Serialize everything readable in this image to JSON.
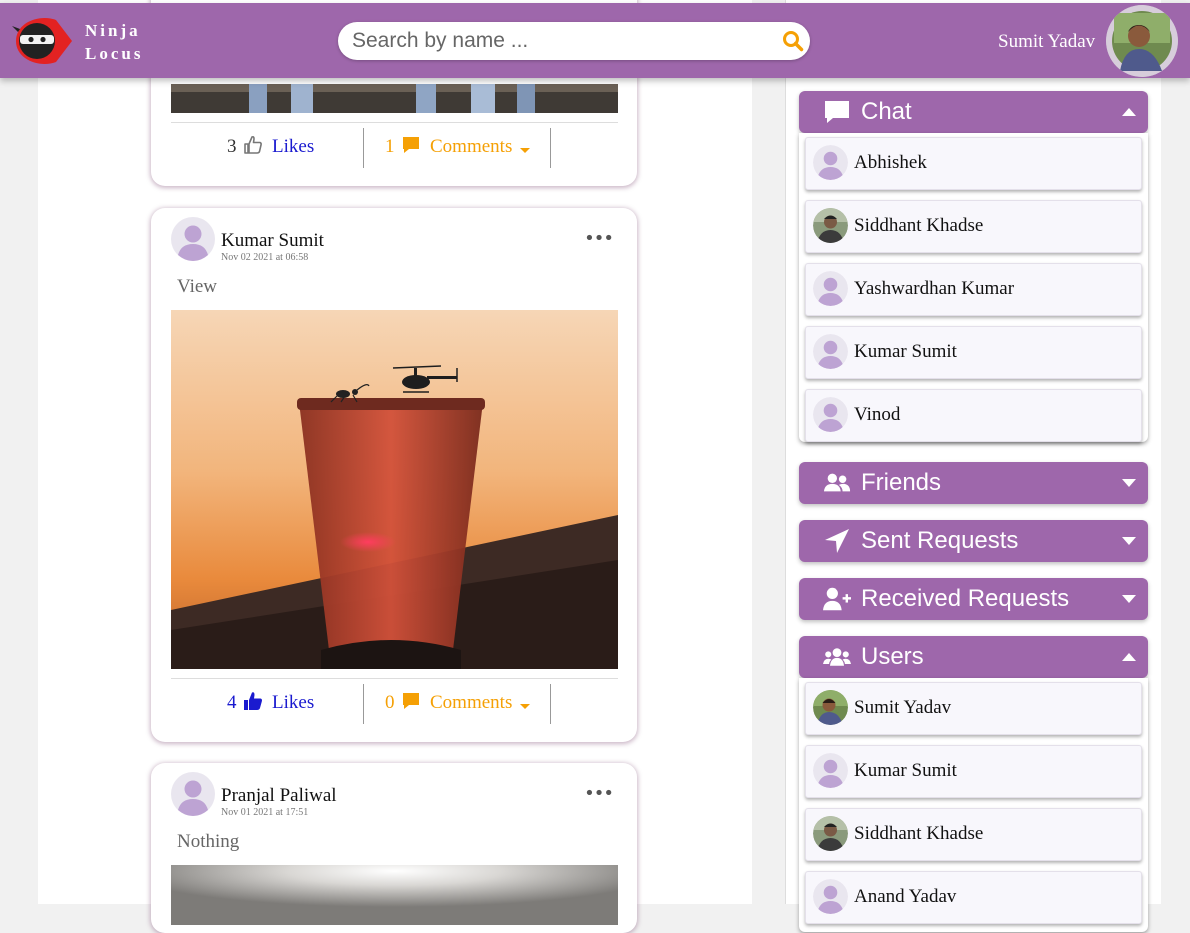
{
  "header": {
    "brand_line1": "Ninja",
    "brand_line2": "Locus",
    "search_placeholder": "Search by name ...",
    "user_name": "Sumit Yadav",
    "accent_color": "#9e67ab"
  },
  "feed": {
    "posts": [
      {
        "likes_count": "3",
        "likes_label": "Likes",
        "liked": false,
        "comments_count": "1",
        "comments_label": "Comments"
      },
      {
        "author": "Kumar Sumit",
        "date": "Nov 02 2021 at 06:58",
        "text": "View",
        "likes_count": "4",
        "likes_label": "Likes",
        "liked": true,
        "comments_count": "0",
        "comments_label": "Comments"
      },
      {
        "author": "Pranjal Paliwal",
        "date": "Nov 01 2021 at 17:51",
        "text": "Nothing"
      }
    ]
  },
  "sidebar": {
    "chat": {
      "title": "Chat",
      "icon": "comment-icon",
      "expanded": true,
      "items": [
        {
          "name": "Abhishek",
          "avatar": "default"
        },
        {
          "name": "Siddhant Khadse",
          "avatar": "photo"
        },
        {
          "name": "Yashwardhan Kumar",
          "avatar": "default"
        },
        {
          "name": "Kumar Sumit",
          "avatar": "default"
        },
        {
          "name": "Vinod",
          "avatar": "default"
        }
      ]
    },
    "friends": {
      "title": "Friends",
      "icon": "user-friends-icon",
      "expanded": false
    },
    "sent_requests": {
      "title": "Sent Requests",
      "icon": "location-arrow-icon",
      "expanded": false
    },
    "received_requests": {
      "title": "Received Requests",
      "icon": "user-plus-icon",
      "expanded": false
    },
    "users": {
      "title": "Users",
      "icon": "users-icon",
      "expanded": true,
      "items": [
        {
          "name": "Sumit Yadav",
          "avatar": "photo"
        },
        {
          "name": "Kumar Sumit",
          "avatar": "default"
        },
        {
          "name": "Siddhant Khadse",
          "avatar": "photo"
        },
        {
          "name": "Anand Yadav",
          "avatar": "default"
        }
      ]
    }
  }
}
